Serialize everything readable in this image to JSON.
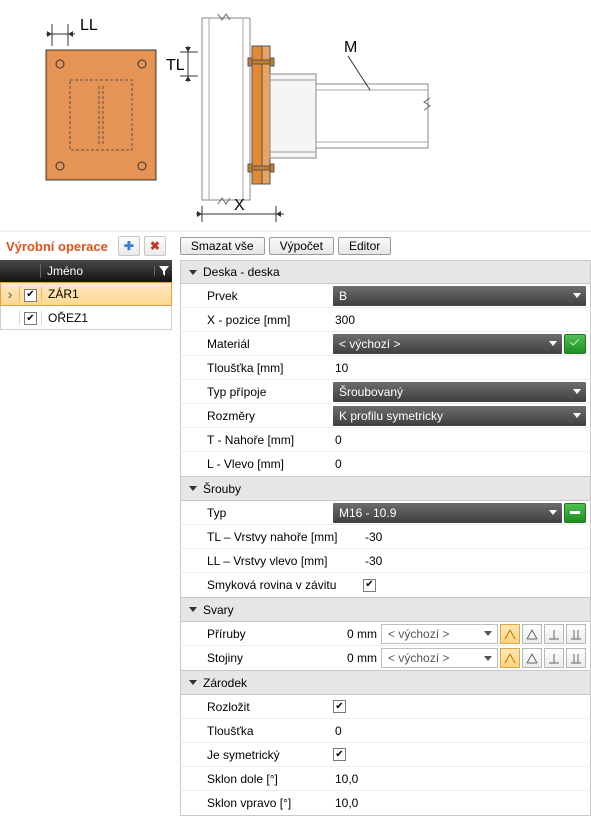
{
  "toolbar": {
    "title": "Výrobní operace",
    "deleteAll": "Smazat vše",
    "calc": "Výpočet",
    "editor": "Editor"
  },
  "leftTable": {
    "header": {
      "name": "Jméno"
    },
    "rows": [
      {
        "selected": true,
        "checked": true,
        "name": "ZÁR1"
      },
      {
        "selected": false,
        "checked": true,
        "name": "OŘEZ1"
      }
    ]
  },
  "groups": {
    "deska": {
      "title": "Deska - deska",
      "prvek_label": "Prvek",
      "prvek_value": "B",
      "xpos_label": "X - pozice [mm]",
      "xpos_value": "300",
      "material_label": "Materiál",
      "material_value": "< výchozí >",
      "thickness_label": "Tloušťka [mm]",
      "thickness_value": "10",
      "typ_label": "Typ přípoje",
      "typ_value": "Šroubovaný",
      "rozm_label": "Rozměry",
      "rozm_value": "K profilu symetricky",
      "t_label": "T - Nahoře [mm]",
      "t_value": "0",
      "l_label": "L - Vlevo [mm]",
      "l_value": "0"
    },
    "srouby": {
      "title": "Šrouby",
      "typ_label": "Typ",
      "typ_value": "M16 - 10.9",
      "tl_label": "TL – Vrstvy nahoře [mm]",
      "tl_value": "-30",
      "ll_label": "LL – Vrstvy vlevo [mm]",
      "ll_value": "-30",
      "smyk_label": "Smyková rovina v závitu",
      "smyk_checked": true
    },
    "svary": {
      "title": "Svary",
      "priruby_label": "Příruby",
      "priruby_value": "0 mm",
      "priruby_combo": "< výchozí >",
      "stojiny_label": "Stojiny",
      "stojiny_value": "0 mm",
      "stojiny_combo": "< výchozí >"
    },
    "zarodek": {
      "title": "Zárodek",
      "rozlozit_label": "Rozložit",
      "rozlozit_checked": true,
      "tl_label": "Tloušťka",
      "tl_value": "0",
      "sym_label": "Je symetrický",
      "sym_checked": true,
      "sklon_dole_label": "Sklon dole [°]",
      "sklon_dole_value": "10,0",
      "sklon_vpravo_label": "Sklon vpravo [°]",
      "sklon_vpravo_value": "10,0"
    }
  },
  "diagram": {
    "LL": "LL",
    "TL": "TL",
    "M": "M",
    "X": "X"
  }
}
